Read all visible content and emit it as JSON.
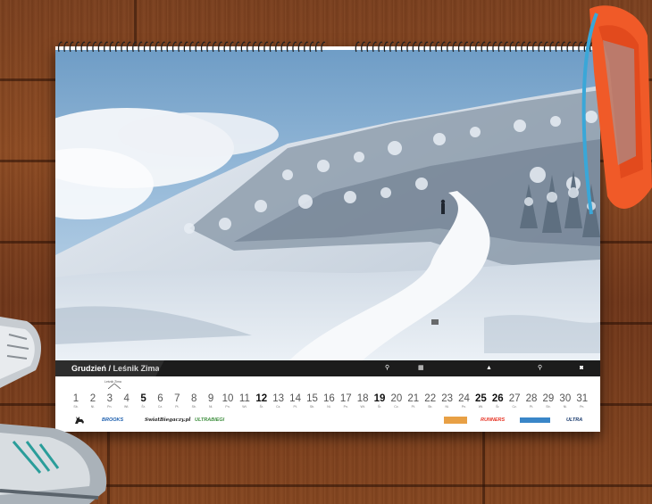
{
  "calendar": {
    "month": "Grudzień",
    "separator": " / ",
    "title": "Leśnik Zima",
    "holiday_note": "Leśnik Zima",
    "days": [
      {
        "n": "1",
        "d": "Sb.",
        "bold": false
      },
      {
        "n": "2",
        "d": "Ni.",
        "bold": false
      },
      {
        "n": "3",
        "d": "Pn.",
        "bold": false
      },
      {
        "n": "4",
        "d": "Wt.",
        "bold": false
      },
      {
        "n": "5",
        "d": "Śr.",
        "bold": true
      },
      {
        "n": "6",
        "d": "Cz.",
        "bold": false
      },
      {
        "n": "7",
        "d": "Pt.",
        "bold": false
      },
      {
        "n": "8",
        "d": "Sb.",
        "bold": false
      },
      {
        "n": "9",
        "d": "Ni.",
        "bold": false
      },
      {
        "n": "10",
        "d": "Pn.",
        "bold": false
      },
      {
        "n": "11",
        "d": "Wt.",
        "bold": false
      },
      {
        "n": "12",
        "d": "Śr.",
        "bold": true
      },
      {
        "n": "13",
        "d": "Cz.",
        "bold": false
      },
      {
        "n": "14",
        "d": "Pt.",
        "bold": false
      },
      {
        "n": "15",
        "d": "Sb.",
        "bold": false
      },
      {
        "n": "16",
        "d": "Ni.",
        "bold": false
      },
      {
        "n": "17",
        "d": "Pn.",
        "bold": false
      },
      {
        "n": "18",
        "d": "Wt.",
        "bold": false
      },
      {
        "n": "19",
        "d": "Śr.",
        "bold": true
      },
      {
        "n": "20",
        "d": "Cz.",
        "bold": false
      },
      {
        "n": "21",
        "d": "Pt.",
        "bold": false
      },
      {
        "n": "22",
        "d": "Sb.",
        "bold": false
      },
      {
        "n": "23",
        "d": "Ni.",
        "bold": false
      },
      {
        "n": "24",
        "d": "Pn.",
        "bold": false
      },
      {
        "n": "25",
        "d": "Wt.",
        "bold": true
      },
      {
        "n": "26",
        "d": "Śr.",
        "bold": true
      },
      {
        "n": "27",
        "d": "Cz.",
        "bold": false
      },
      {
        "n": "28",
        "d": "Pt.",
        "bold": false
      },
      {
        "n": "29",
        "d": "Sb.",
        "bold": false
      },
      {
        "n": "30",
        "d": "Ni.",
        "bold": false
      },
      {
        "n": "31",
        "d": "Pn.",
        "bold": false
      }
    ],
    "sponsors": [
      "BROOKS",
      "SwiatBiegaczy.pl",
      "ULTRABIEGI",
      "RUNNERS",
      "ULTRA"
    ],
    "accent_color": "#e63324",
    "strip_color": "#1c1c1c"
  },
  "icons": [
    "location-pin-icon",
    "calendar-icon",
    "mountain-icon",
    "camera-icon",
    "deer-logo-icon"
  ]
}
